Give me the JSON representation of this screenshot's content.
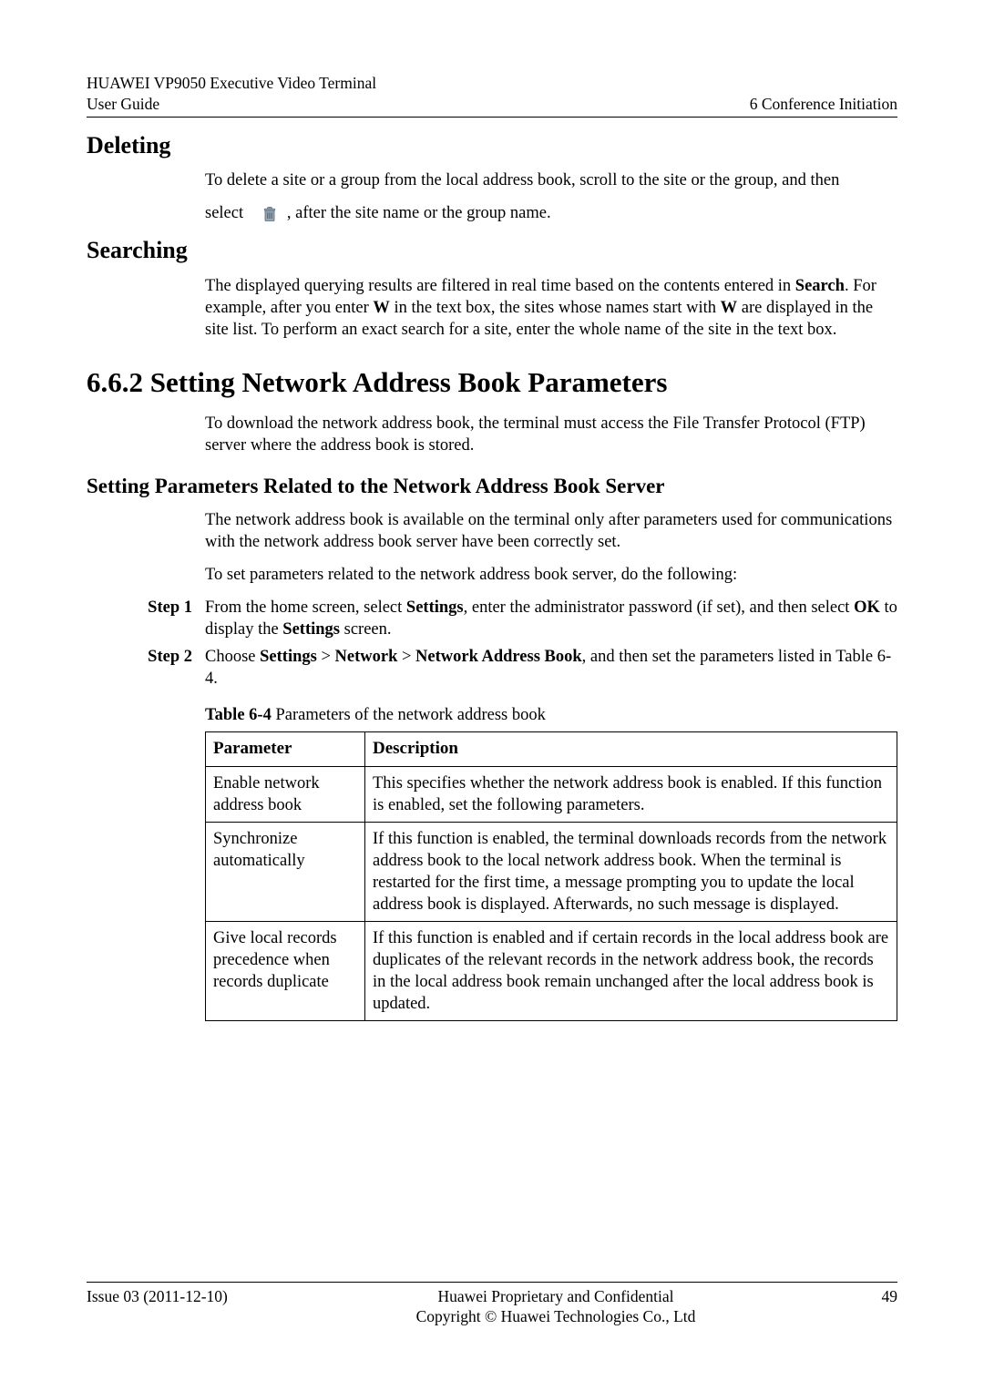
{
  "header": {
    "left_line1": "HUAWEI VP9050 Executive Video Terminal",
    "left_line2": "User Guide",
    "right": "6 Conference Initiation"
  },
  "sec_delete": {
    "title": "Deleting",
    "p1_part1": "To delete a site or a group from the local address book, scroll to the site or the group, and then",
    "p2_select": "select",
    "p2_rest": ", after the site name or the group name."
  },
  "sec_search": {
    "title": "Searching",
    "p1_a": "The displayed querying results are filtered in real time based on the contents entered in ",
    "p1_b": "Search",
    "p1_c": ". For example, after you enter ",
    "p1_d": "W",
    "p1_e": " in the text box, the sites whose names start with ",
    "p1_f": "W",
    "p1_g": " are displayed in the site list. To perform an exact search for a site, enter the whole name of the site in the text box."
  },
  "sec_662": {
    "title": "6.6.2 Setting Network Address Book Parameters",
    "p1": "To download the network address book, the terminal must access the File Transfer Protocol (FTP) server where the address book is stored."
  },
  "sec_setparams": {
    "title": "Setting Parameters Related to the Network Address Book Server",
    "p1": "The network address book is available on the terminal only after parameters used for communications with the network address book server have been correctly set.",
    "p2": "To set parameters related to the network address book server, do the following:"
  },
  "steps": {
    "s1_label": "Step 1",
    "s1_a": "From the home screen, select ",
    "s1_b": "Settings",
    "s1_c": ", enter the administrator password (if set), and then select ",
    "s1_d": "OK",
    "s1_e": " to display the ",
    "s1_f": "Settings",
    "s1_g": " screen.",
    "s2_label": "Step 2",
    "s2_a": "Choose ",
    "s2_b": "Settings",
    "s2_c": " > ",
    "s2_d": "Network",
    "s2_e": " > ",
    "s2_f": "Network Address Book",
    "s2_g": ", and then set the parameters listed in Table 6-4."
  },
  "table": {
    "caption_b": "Table 6-4",
    "caption_rest": " Parameters of the network address book",
    "head_param": "Parameter",
    "head_desc": "Description",
    "rows": [
      {
        "param": "Enable network address book",
        "desc": "This specifies whether the network address book is enabled. If this function is enabled, set the following parameters."
      },
      {
        "param": "Synchronize automatically",
        "desc": "If this function is enabled, the terminal downloads records from the network address book to the local network address book. When the terminal is restarted for the first time, a message prompting you to update the local address book is displayed. Afterwards, no such message is displayed."
      },
      {
        "param": "Give local records precedence when records duplicate",
        "desc": "If this function is enabled and if certain records in the local address book are duplicates of the relevant records in the network address book, the records in the local address book remain unchanged after the local address book is updated."
      }
    ]
  },
  "footer": {
    "issue": "Issue 03 (2011-12-10)",
    "mid1": "Huawei Proprietary and Confidential",
    "mid2": "Copyright © Huawei Technologies Co., Ltd",
    "page": "49"
  }
}
